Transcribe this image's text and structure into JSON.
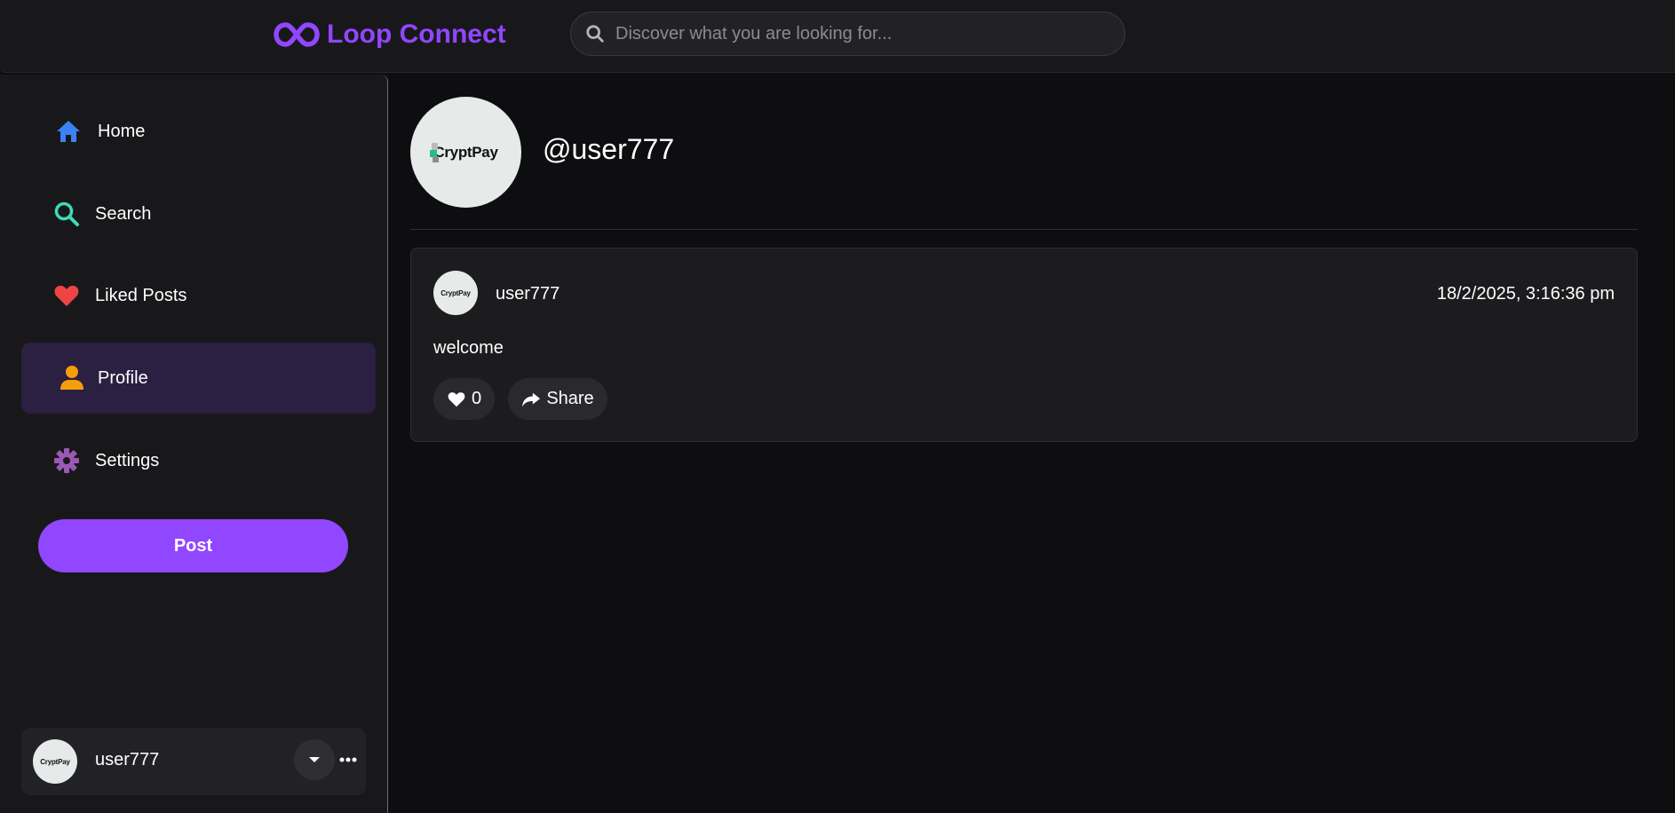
{
  "header": {
    "brand": "Loop Connect",
    "brand_color": "#9146ff",
    "logo_icon": "infinity-icon",
    "search_placeholder": "Discover what you are looking for...",
    "search_icon": "search-icon"
  },
  "sidebar": {
    "items": [
      {
        "label": "Home",
        "icon": "home-icon",
        "icon_color": "#3b82f6",
        "active": false
      },
      {
        "label": "Search",
        "icon": "search-icon",
        "icon_color": "#3ddbb8",
        "active": false
      },
      {
        "label": "Liked Posts",
        "icon": "heart-icon",
        "icon_color": "#ef4444",
        "active": false
      },
      {
        "label": "Profile",
        "icon": "user-icon",
        "icon_color": "#f59e0b",
        "active": true
      },
      {
        "label": "Settings",
        "icon": "gear-icon",
        "icon_color": "#9b59b6",
        "active": false
      }
    ],
    "post_button": "Post",
    "current_user": {
      "name": "user777",
      "avatar_text": "CryptPay"
    }
  },
  "profile": {
    "handle": "@user777",
    "avatar_text": "CryptPay"
  },
  "posts": [
    {
      "author": "user777",
      "timestamp": "18/2/2025, 3:16:36 pm",
      "content": "welcome",
      "likes": "0",
      "share_label": "Share",
      "avatar_text": "CryptPay"
    }
  ]
}
